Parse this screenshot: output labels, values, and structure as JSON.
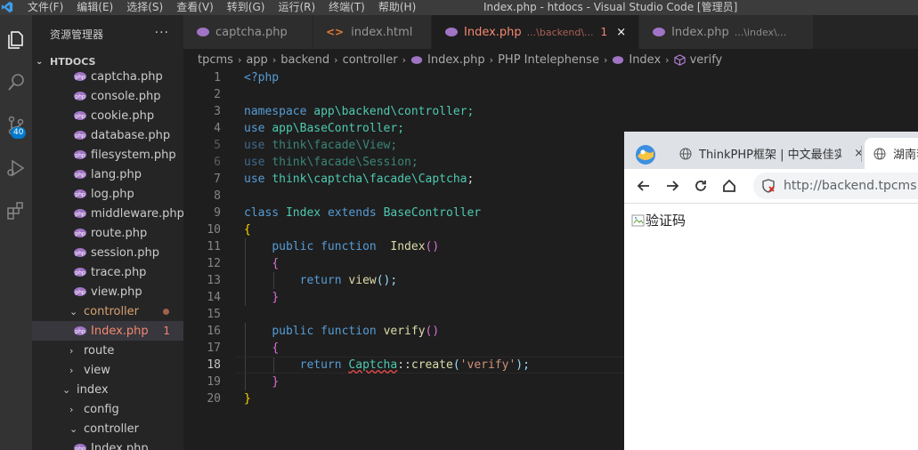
{
  "titlebar": {
    "menu": [
      "文件(F)",
      "编辑(E)",
      "选择(S)",
      "查看(V)",
      "转到(G)",
      "运行(R)",
      "终端(T)",
      "帮助(H)"
    ],
    "title": "Index.php - htdocs - Visual Studio Code [管理员]"
  },
  "activity": {
    "scm_badge": "40"
  },
  "sidebar": {
    "title": "资源管理器",
    "more": "···",
    "root": "HTDOCS",
    "items": [
      {
        "label": "captcha.php"
      },
      {
        "label": "console.php"
      },
      {
        "label": "cookie.php"
      },
      {
        "label": "database.php"
      },
      {
        "label": "filesystem.php"
      },
      {
        "label": "lang.php"
      },
      {
        "label": "log.php"
      },
      {
        "label": "middleware.php"
      },
      {
        "label": "route.php"
      },
      {
        "label": "session.php"
      },
      {
        "label": "trace.php"
      },
      {
        "label": "view.php"
      }
    ],
    "controller_folder": "controller",
    "active_file": "Index.php",
    "active_count": "1",
    "folders": [
      "route",
      "view"
    ],
    "index_folder": "index",
    "index_children": [
      "config",
      "controller"
    ],
    "last_file": "Index.php"
  },
  "tabs": [
    {
      "label": "captcha.php"
    },
    {
      "label": "index.html"
    },
    {
      "label": "Index.php",
      "desc": "...\\backend\\...",
      "count": "1",
      "close": "×"
    },
    {
      "label": "Index.php",
      "desc": "...\\index\\..."
    }
  ],
  "breadcrumbs": [
    "tpcms",
    "app",
    "backend",
    "controller",
    "Index.php",
    "PHP Intelephense",
    "Index",
    "verify"
  ],
  "code": {
    "line_numbers": [
      "1",
      "2",
      "3",
      "4",
      "5",
      "6",
      "7",
      "8",
      "9",
      "10",
      "11",
      "12",
      "13",
      "14",
      "15",
      "16",
      "17",
      "18",
      "19",
      "20"
    ],
    "current_line": 18,
    "l1": "<?php",
    "l3_kw": "namespace",
    "l3_ns": "app\\backend\\controller;",
    "use": "use",
    "l4": "app\\BaseController;",
    "l5_a": "think\\facade\\",
    "l5_b": "View;",
    "l6_a": "think\\facade\\",
    "l6_b": "Session;",
    "l7_a": "think\\captcha\\facade\\",
    "l7_b": "Captcha",
    "semi": ";",
    "class_kw": "class",
    "class_name": "Index",
    "extends_kw": "extends",
    "base": "BaseController",
    "brace_open": "{",
    "brace_close": "}",
    "public_kw": "public",
    "function_kw": "function",
    "fn1": "Index",
    "parens": "()",
    "return_kw": "return",
    "view_fn": "view",
    "l13_tail": "();",
    "fn2": "verify",
    "captcha_cls": "Captcha",
    "dcolon": "::",
    "create_fn": "create",
    "paren_open": "(",
    "verify_str": "'verify'",
    "paren_close_semi": ");"
  },
  "browser": {
    "tab1": "ThinkPHP框架 | 中文最佳实践",
    "tab1_close": "×",
    "tab2": "湖南套",
    "url": "http://backend.tpcms.c",
    "content_alt": "验证码"
  }
}
